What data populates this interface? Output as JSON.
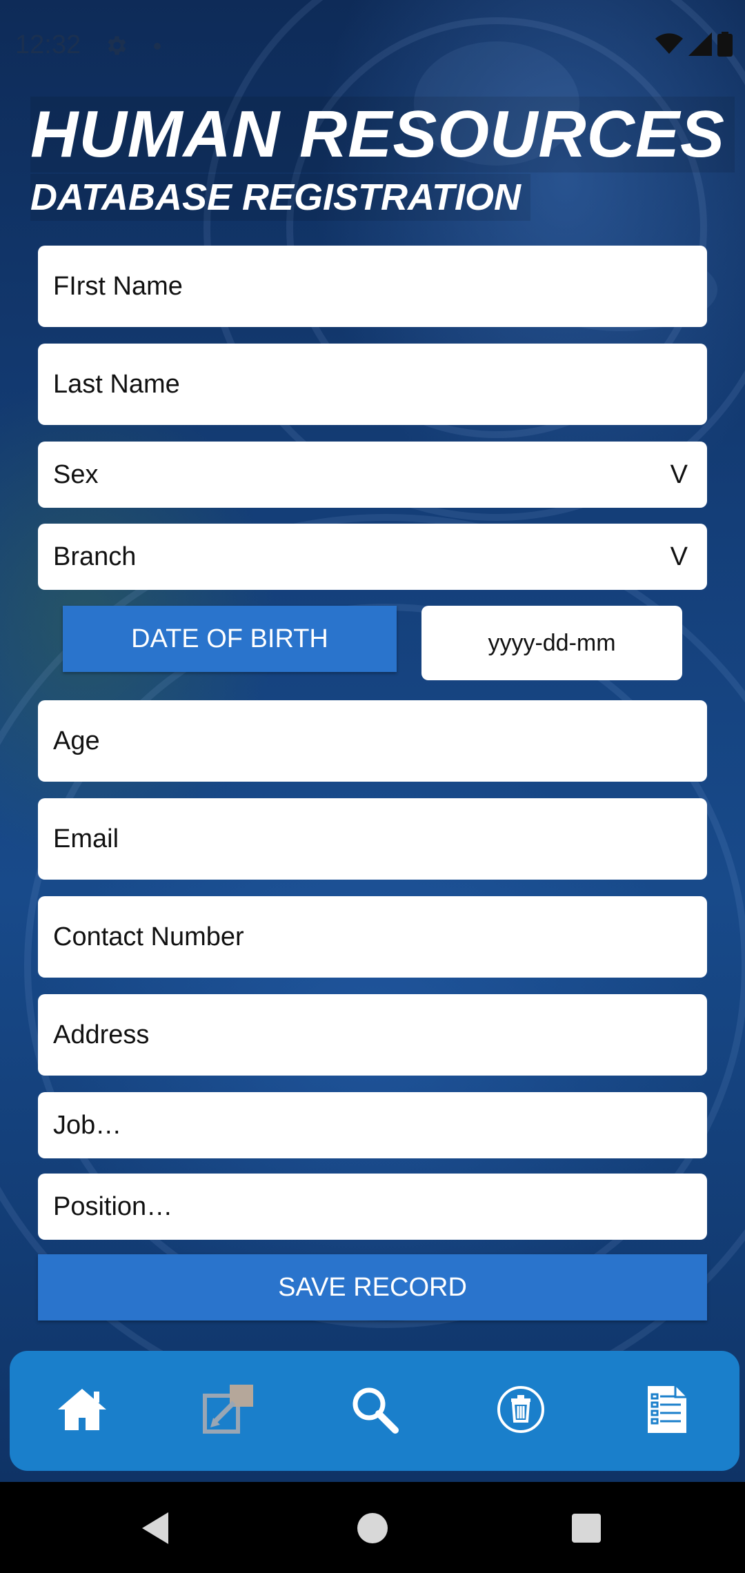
{
  "status_bar": {
    "time": "12:32"
  },
  "header": {
    "title": "HUMAN RESOURCES",
    "subtitle": "DATABASE REGISTRATION"
  },
  "form": {
    "first_name_placeholder": "FIrst Name",
    "last_name_placeholder": "Last Name",
    "sex_label": "Sex",
    "sex_arrow": "V",
    "branch_label": "Branch",
    "branch_arrow": "V",
    "dob_button_label": "DATE OF BIRTH",
    "dob_value": "yyyy-dd-mm",
    "age_placeholder": "Age",
    "email_placeholder": "Email",
    "contact_placeholder": "Contact Number",
    "address_placeholder": "Address",
    "job_label": "Job…",
    "position_label": "Position…",
    "save_label": "SAVE RECORD"
  },
  "bottom_nav": {
    "items": [
      {
        "icon": "home-icon"
      },
      {
        "icon": "edit-icon"
      },
      {
        "icon": "search-icon"
      },
      {
        "icon": "delete-icon"
      },
      {
        "icon": "list-icon"
      }
    ]
  },
  "colors": {
    "accent": "#2a74cc",
    "nav_bar": "#1a7fcb",
    "background": "#143e78"
  }
}
